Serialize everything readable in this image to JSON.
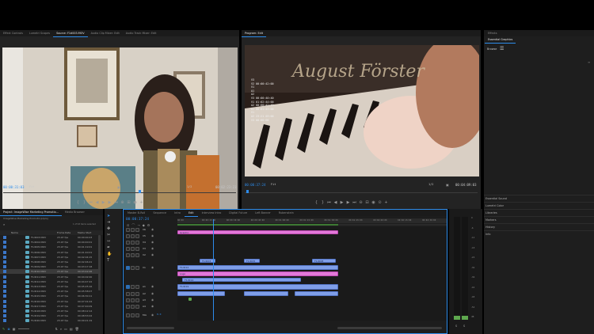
{
  "source_monitor": {
    "tabs": [
      "Effect Controls",
      "Lumetri Scopes",
      "Source: F1d003.MOV",
      "Audio Clip Mixer: Edit",
      "Audio Track Mixer: Edit"
    ],
    "active_tab": 2,
    "timecode_left": "00:00:31:03",
    "fit": "Fit",
    "quality": "1/2",
    "timecode_right": "00:02:23:23"
  },
  "program_monitor": {
    "tab": "Program: Edit",
    "video_text": "August Förster",
    "overlay_lines": [
      "V3",
      "V2 00:00:42:00",
      "V1",
      "A1",
      "A2",
      "V3 00:00:40:40",
      "V1 01:02:44:00",
      "A2 00:00:42:42",
      "A1 00:01:43:00",
      "V1",
      "A2 23:21 03:00",
      "V3 00:00:00"
    ],
    "timecode_left": "00:00:37:24",
    "fit": "Fit",
    "quality": "1/2",
    "timecode_right": "00:04:09:03"
  },
  "right_panel": {
    "tabs": [
      "Effects",
      "Essential Graphics"
    ],
    "browse": "Browse",
    "lower_items": [
      "Essential Sound",
      "Lumetri Color",
      "Libraries",
      "Markers",
      "History",
      "Info"
    ]
  },
  "project": {
    "tabs": [
      "Project: ImageWise Marketing Promotio...",
      "Media Browser"
    ],
    "filename": "ImageWise Marketing Promotio.prproj",
    "item_count": "1 of 63 items selected",
    "columns": [
      "Name",
      "Frame Rate",
      "Media Start"
    ],
    "rows": [
      {
        "name": "F1d003.MOV",
        "rate": "23.97 fps",
        "start": "00:00:00:23"
      },
      {
        "name": "F1d004.MOV",
        "rate": "23.97 fps",
        "start": "00:00:40:01"
      },
      {
        "name": "F1d005.MOV",
        "rate": "23.97 fps",
        "start": "00:01:19:01"
      },
      {
        "name": "F1d006.MOV",
        "rate": "23.97 fps",
        "start": "00:01:40:01"
      },
      {
        "name": "F1d007.MOV",
        "rate": "23.97 fps",
        "start": "00:02:04:15"
      },
      {
        "name": "F1d008.MOV",
        "rate": "23.97 fps",
        "start": "00:02:46:21"
      },
      {
        "name": "F1d009.MOV",
        "rate": "23.97 fps",
        "start": "00:03:17:18"
      },
      {
        "name": "F1d010.MOV",
        "rate": "23.97 fps",
        "start": "00:03:42:06"
      },
      {
        "name": "F1d011.MOV",
        "rate": "23.97 fps",
        "start": "00:04:02:00"
      },
      {
        "name": "F1d012.MOV",
        "rate": "23.97 fps",
        "start": "00:04:47:22"
      },
      {
        "name": "F1d013.MOV",
        "rate": "23.97 fps",
        "start": "00:05:25:16"
      },
      {
        "name": "F1d014.MOV",
        "rate": "23.97 fps",
        "start": "00:05:58:07"
      },
      {
        "name": "F1d015.MOV",
        "rate": "23.97 fps",
        "start": "00:06:30:11"
      },
      {
        "name": "F1d016.MOV",
        "rate": "23.97 fps",
        "start": "00:07:01:04"
      },
      {
        "name": "F1d017.MOV",
        "rate": "23.97 fps",
        "start": "00:07:40:09"
      },
      {
        "name": "F1d018.MOV",
        "rate": "23.97 fps",
        "start": "00:08:12:14"
      },
      {
        "name": "F1d019.MOV",
        "rate": "23.97 fps",
        "start": "00:08:53:02"
      },
      {
        "name": "F1d020.MOV",
        "rate": "23.97 fps",
        "start": "00:09:21:19"
      }
    ]
  },
  "timeline": {
    "tabs": [
      "Master B-Roll",
      "Sequence",
      "Intro",
      "Edit",
      "Interview Intro",
      "Digital Future",
      "Left Banner",
      "Rubenstein"
    ],
    "active_tab": 3,
    "timecode": "00:00:37:24",
    "ruler_ticks": [
      "00:00",
      "00:00:15:00",
      "00:00:30:00",
      "00:00:45:00",
      "00:01:00:00",
      "00:01:15:00",
      "00:01:30:00",
      "00:01:45:00",
      "00:02:00:00",
      "00:02:15:00",
      "00:02:30:00"
    ],
    "tracks": [
      "V6",
      "V5",
      "V4",
      "V3",
      "V2",
      "V1",
      "A1",
      "A2",
      "A3",
      "A4",
      "Mix"
    ],
    "clip_labels": {
      "pink_top": "Graphic",
      "pink_v1": "Logo",
      "blue_a": "F1d003",
      "blue_b": "F1d005",
      "blue_c": "F1d008",
      "blue_d": "F1d012",
      "blue_e": "F1d014",
      "blue_f": "F1d019"
    },
    "mix_value": "0.0"
  },
  "audio_meter": {
    "scale": [
      "0",
      "-6",
      "-12",
      "-18",
      "-24",
      "-30",
      "-36",
      "-42",
      "-48",
      "-54",
      "dB"
    ],
    "labels": [
      "S",
      "S"
    ]
  },
  "colors": {
    "accent": "#2d8ceb",
    "pink": "#e279d8",
    "blue_clip": "#7f9ee8",
    "green": "#5ea84e"
  }
}
